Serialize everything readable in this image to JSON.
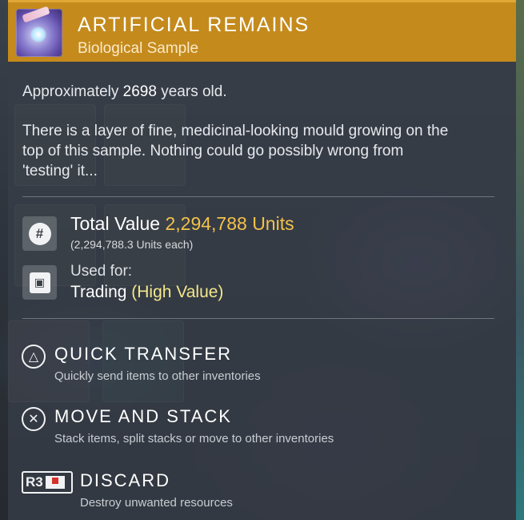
{
  "item": {
    "title": "ARTIFICIAL REMAINS",
    "subtitle": "Biological Sample",
    "icon": "sample-jar-icon"
  },
  "description": {
    "age_prefix": "Approximately ",
    "age_value": "2698",
    "age_suffix": " years old.",
    "lines": [
      "There is a layer of fine, medicinal-looking mould growing on the",
      "top of this sample. Nothing could go possibly wrong from",
      "'testing' it..."
    ]
  },
  "value": {
    "label": "Total Value ",
    "amount": "2,294,788 Units",
    "each": "(2,294,788.3 Units each)",
    "icon": "units-icon"
  },
  "usage": {
    "label": "Used for:",
    "value_prefix": "Trading ",
    "value_accent": "(High Value)",
    "icon": "chip-icon"
  },
  "actions": [
    {
      "glyph": "△",
      "title": "QUICK TRANSFER",
      "subtitle": "Quickly send items to other inventories"
    },
    {
      "glyph": "✕",
      "title": "MOVE AND STACK",
      "subtitle": "Stack items, split stacks or move to other inventories"
    },
    {
      "glyph": "R3",
      "title": "DISCARD",
      "subtitle": "Destroy unwanted resources"
    }
  ],
  "colors": {
    "header": "#c48a1c",
    "value_gold": "#f2c24b",
    "high_value": "#f4e78a"
  }
}
